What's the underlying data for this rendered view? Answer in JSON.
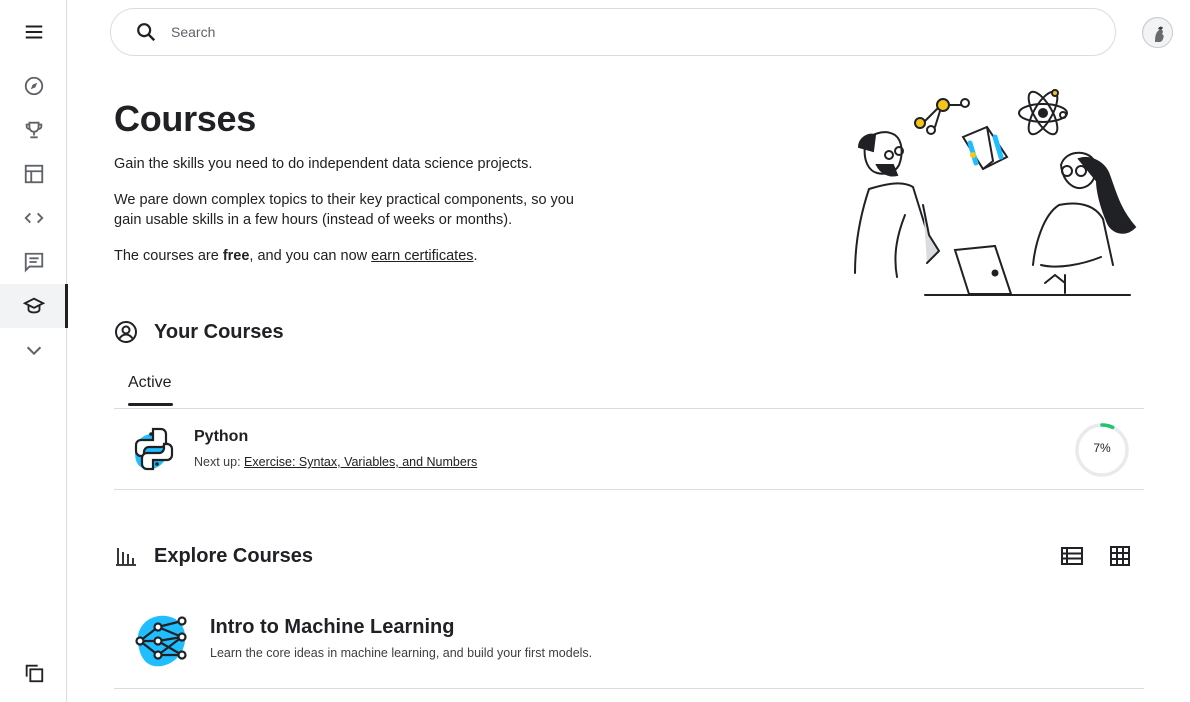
{
  "sidebar": {
    "items": [
      {
        "icon": "menu-icon"
      },
      {
        "icon": "compass-icon"
      },
      {
        "icon": "trophy-icon"
      },
      {
        "icon": "table-icon"
      },
      {
        "icon": "code-icon"
      },
      {
        "icon": "comment-icon"
      },
      {
        "icon": "school-icon",
        "active": true
      },
      {
        "icon": "chevron-down-icon"
      },
      {
        "icon": "copy-icon"
      }
    ]
  },
  "search": {
    "placeholder": "Search"
  },
  "hero": {
    "title": "Courses",
    "p1": "Gain the skills you need to do independent data science projects.",
    "p2": "We pare down complex topics to their key practical components, so you gain usable skills in a few hours (instead of weeks or months).",
    "p3_before": "The courses are ",
    "p3_bold": "free",
    "p3_middle": ", and you can now ",
    "p3_link": "earn certificates",
    "p3_after": "."
  },
  "your_courses": {
    "title": "Your Courses",
    "tab": "Active",
    "courses": [
      {
        "name": "Python",
        "next_label": "Next up: ",
        "next_link": "Exercise: Syntax, Variables, and Numbers",
        "progress_text": "7%",
        "progress": 0.07
      }
    ]
  },
  "explore": {
    "title": "Explore Courses",
    "courses": [
      {
        "name": "Intro to Machine Learning",
        "description": "Learn the core ideas in machine learning, and build your first models."
      }
    ]
  },
  "colors": {
    "accent_blue": "#20beff",
    "progress_green": "#1ec670",
    "progress_track": "#e8eaed"
  }
}
